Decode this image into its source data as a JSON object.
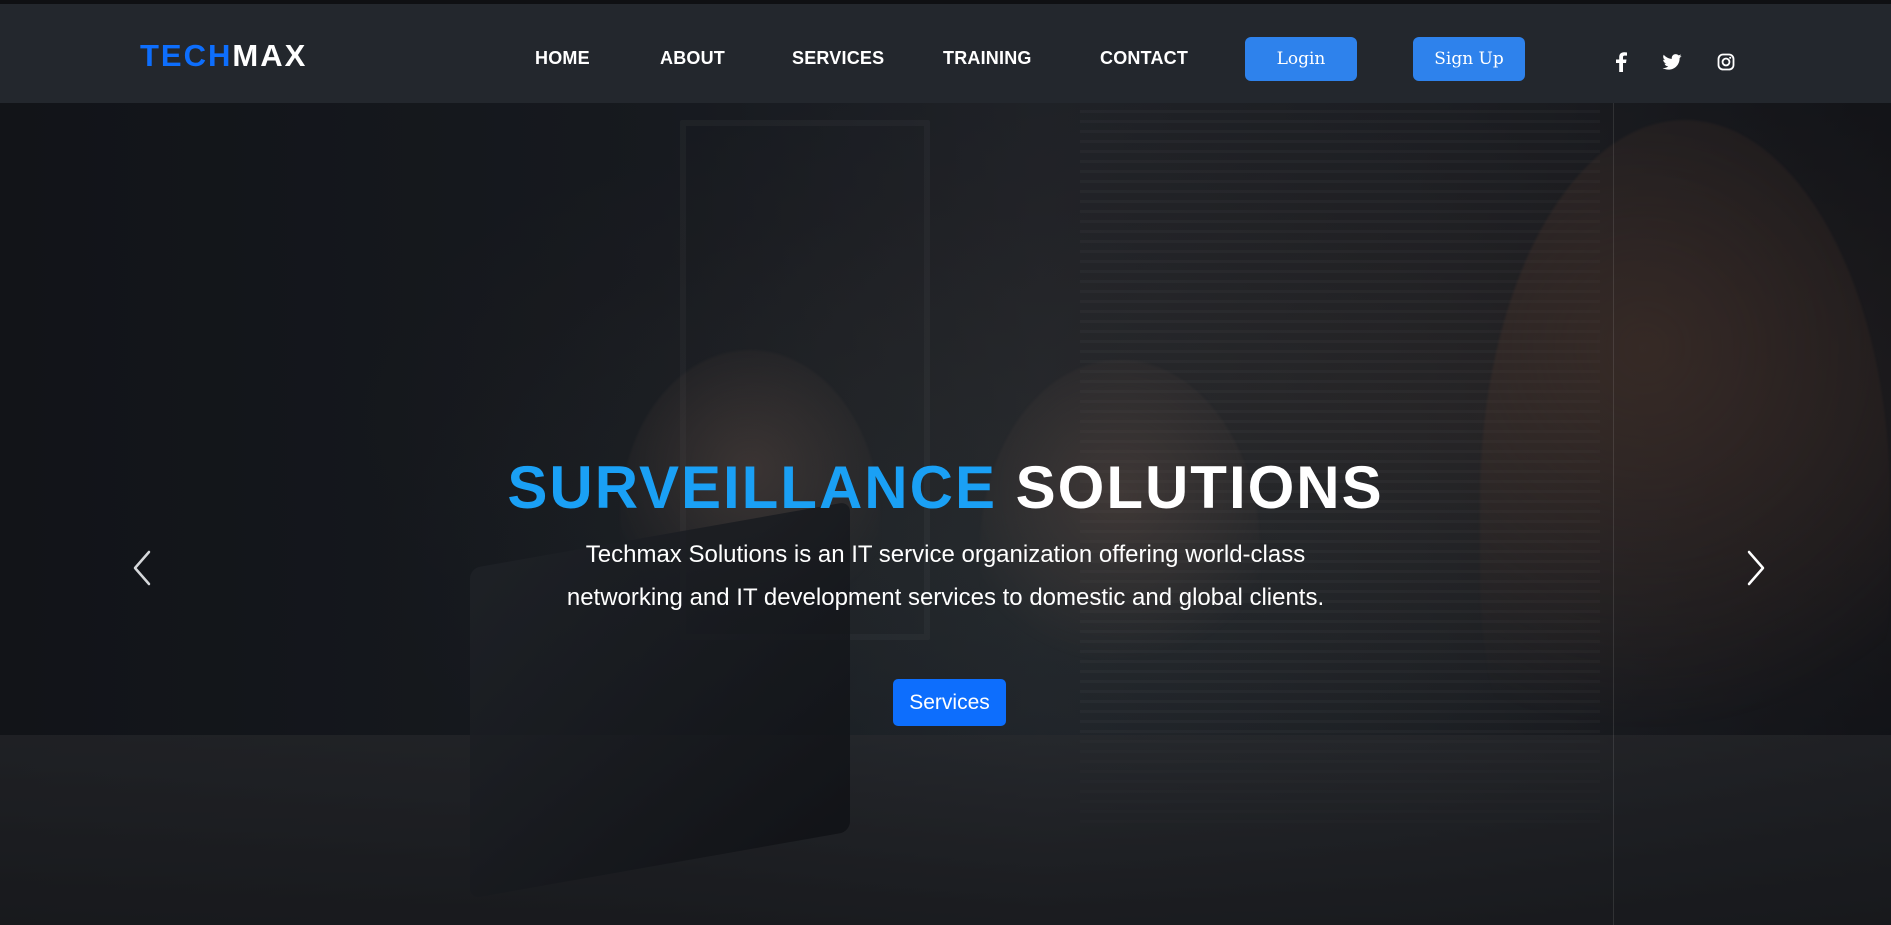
{
  "header": {
    "logo": {
      "part1": "TECH",
      "part2": "MAX"
    },
    "nav": [
      "HOME",
      "ABOUT",
      "SERVICES",
      "TRAINING",
      "CONTACT"
    ],
    "login_label": "Login",
    "signup_label": "Sign Up",
    "social_icons": [
      "facebook-icon",
      "twitter-icon",
      "instagram-icon"
    ]
  },
  "hero": {
    "title_part1": "SURVEILLANCE",
    "title_part2": "SOLUTIONS",
    "description": "Techmax Solutions is an IT service organization offering world-class networking and IT development services to domestic and global clients.",
    "button_label": "Services",
    "prev_icon": "chevron-left-icon",
    "next_icon": "chevron-right-icon"
  },
  "colors": {
    "brand_blue": "#0d6efd",
    "title_blue": "#1aa0f5",
    "button_blue": "#2e82ec",
    "navbar_bg": "#23272d"
  }
}
